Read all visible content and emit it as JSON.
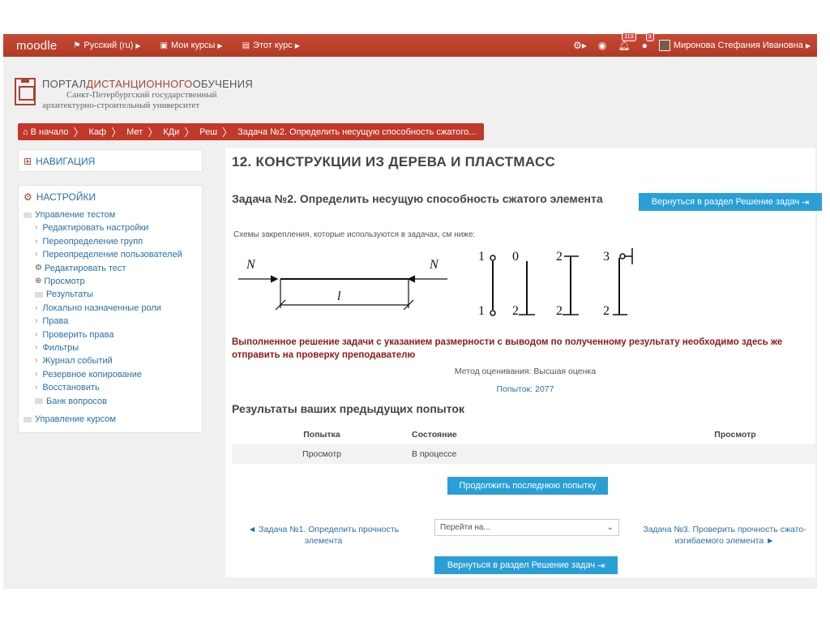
{
  "navbar": {
    "brand": "moodle",
    "lang": "Русский (ru)",
    "my_courses": "Мои курсы",
    "this_course": "Этот курс",
    "notifications_count": "113",
    "messages_count": "3",
    "user_name": "Миронова Стефания Ивановна"
  },
  "logo": {
    "part1": "ПОРТАЛ",
    "part2": "ДИСТАНЦИОННОГО",
    "part3": "ОБУЧЕНИЯ",
    "line2": "Санкт-Петербургский государственный",
    "line3": "архитектурно-строительный университет"
  },
  "breadcrumb": [
    "В начало",
    "Каф",
    "Мет",
    "КДи",
    "Реш",
    "Задача №2. Определить несущую способность сжатого..."
  ],
  "sidebar": {
    "navigation_title": "НАВИГАЦИЯ",
    "settings_title": "НАСТРОЙКИ",
    "quiz_admin": "Управление тестом",
    "items": [
      "Редактировать настройки",
      "Переопределение групп",
      "Переопределение пользователей",
      "Редактировать тест",
      "Просмотр",
      "Результаты",
      "Локально назначенные роли",
      "Права",
      "Проверить права",
      "Фильтры",
      "Журнал событий",
      "Резервное копирование",
      "Восстановить",
      "Банк вопросов"
    ],
    "course_admin": "Управление курсом"
  },
  "main": {
    "course_title": "12. КОНСТРУКЦИИ ИЗ ДЕРЕВА И ПЛАСТМАСС",
    "task_title": "Задача №2. Определить несущую способность сжатого элемента",
    "back_button": "Вернуться в раздел Решение задач",
    "schemes_note": "Схемы закрепления, которые используются в задачах, см ниже:",
    "diagram": {
      "force_left": "N",
      "force_right": "N",
      "length": "l",
      "s1_top": "1",
      "s1_bottom": "1",
      "s2_top": "0",
      "s2_bottom": "2",
      "s3_top": "2",
      "s3_bottom": "2",
      "s4_top": "3",
      "s4_bottom": "2"
    },
    "warning": "Выполненное решение задачи с указанием размерности с выводом по полученному результату необходимо здесь же отправить на проверку преподавателю",
    "grading": "Метод оценивания: Высшая оценка",
    "attempts": "Попыток: 2077",
    "prev_title": "Результаты ваших предыдущих попыток",
    "table": {
      "headers": [
        "Попытка",
        "Состояние",
        "Просмотр"
      ],
      "row": [
        "Просмотр",
        "В процессе",
        ""
      ]
    },
    "continue_button": "Продолжить последнюю попытку",
    "prev_link": "◄ Задача №1. Определить прочность элемента",
    "jump_placeholder": "Перейти на...",
    "next_link": "Задача №3. Проверить прочность сжато-изгибаемого элемента ►"
  }
}
